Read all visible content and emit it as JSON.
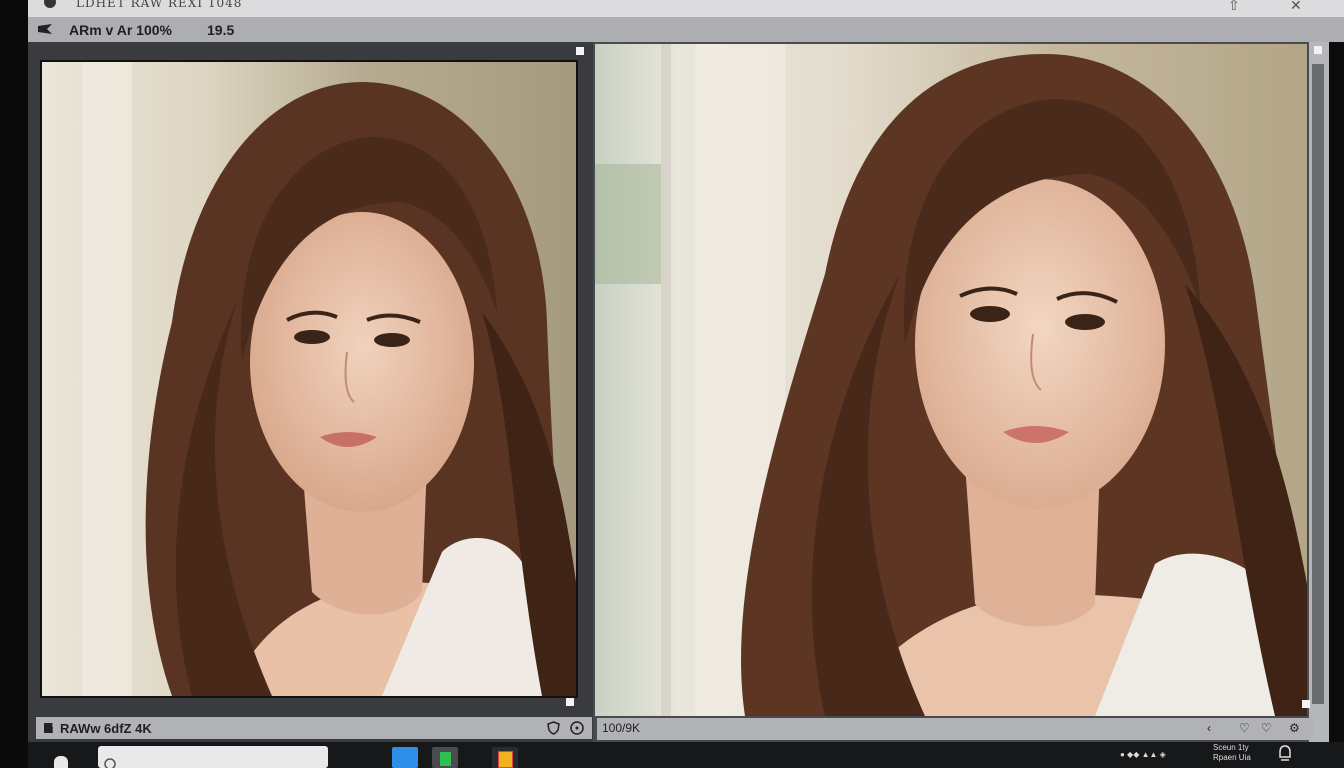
{
  "window": {
    "title": "LDHET RAW REXI 1048",
    "minimize_glyph": "⇧",
    "close_glyph": "✕"
  },
  "toolbar": {
    "view_label": "ARm v Ar 100%",
    "zoom_value": "19.5"
  },
  "left_pane": {
    "status_text": "RAWw 6dfZ 4K",
    "status_prefix": "i",
    "icons": [
      "shield-icon",
      "help-icon"
    ]
  },
  "right_pane": {
    "status_text": "100/9K",
    "icons": [
      "info-icon",
      "heart-icon",
      "heart-icon",
      "settings-icon"
    ]
  },
  "taskbar": {
    "tray_line1": "Sceun 1ty",
    "tray_line2": "Rpaen Uia",
    "apps": [
      {
        "name": "explorer-app",
        "color": "#2f8ee8"
      },
      {
        "name": "green-app",
        "color": "#2fbf4f"
      },
      {
        "name": "orange-app",
        "color": "#f2b21e"
      }
    ]
  },
  "colors": {
    "toolbar_bg": "#adaeb1",
    "pane_bg": "#3a3b3e",
    "taskbar_bg": "#17181a"
  }
}
